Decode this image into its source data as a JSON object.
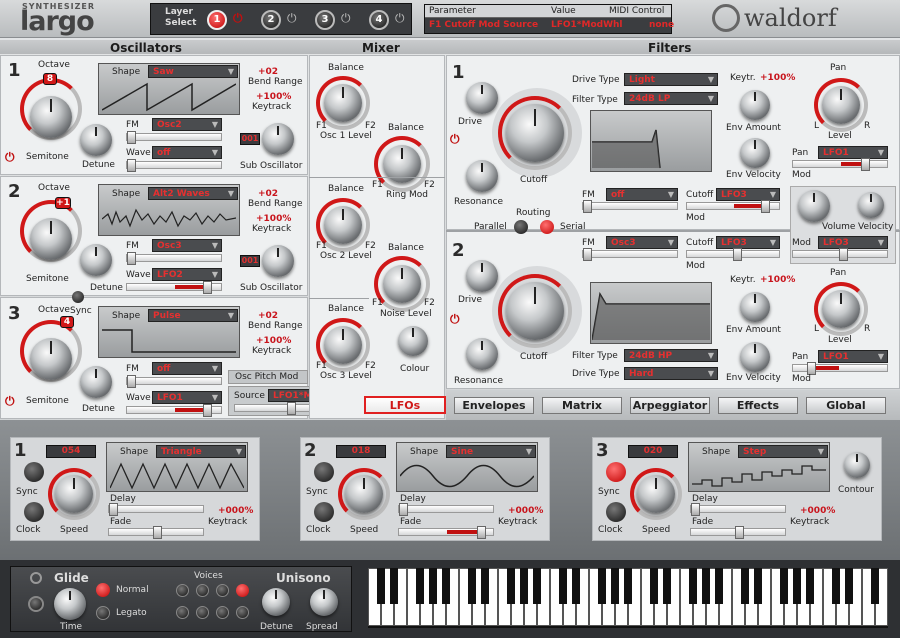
{
  "brand": {
    "top": "SYNTHESIZER",
    "product": "largo",
    "maker": "waldorf"
  },
  "layer_select": {
    "label1": "Layer",
    "label2": "Select",
    "layers": [
      "1",
      "2",
      "3",
      "4"
    ]
  },
  "param_display": {
    "h_param": "Parameter",
    "h_value": "Value",
    "h_midi": "MIDI Control",
    "param": "F1 Cutoff Mod Source",
    "value": "LFO1*ModWhl",
    "midi": "none"
  },
  "sections": {
    "osc": "Oscillators",
    "mixer": "Mixer",
    "filters": "Filters"
  },
  "oscillators": [
    {
      "num": "1",
      "octave_label": "Octave",
      "octave": "8",
      "shape_label": "Shape",
      "shape": "Saw",
      "bend": "+02",
      "bend_label": "Bend Range",
      "keytrack": "+100%",
      "keytrack_label": "Keytrack",
      "fm_label": "FM",
      "fm": "Osc2",
      "wave_label": "Wave",
      "wave": "off",
      "semitone": "Semitone",
      "detune": "Detune",
      "sub_value": "001",
      "sub_label": "Sub Oscillator"
    },
    {
      "num": "2",
      "octave_label": "Octave",
      "octave": "+1",
      "shape_label": "Shape",
      "shape": "Alt2 Waves",
      "bend": "+02",
      "bend_label": "Bend Range",
      "keytrack": "+100%",
      "keytrack_label": "Keytrack",
      "fm_label": "FM",
      "fm": "Osc3",
      "wave_label": "Wave",
      "wave": "LFO2",
      "semitone": "Semitone",
      "detune": "Detune",
      "sub_value": "001",
      "sub_label": "Sub Oscillator"
    },
    {
      "num": "3",
      "octave_label": "Octave",
      "octave": "4",
      "shape_label": "Shape",
      "shape": "Pulse",
      "bend": "+02",
      "bend_label": "Bend Range",
      "keytrack": "+100%",
      "keytrack_label": "Keytrack",
      "fm_label": "FM",
      "fm": "off",
      "wave_label": "Wave",
      "wave": "LFO1",
      "semitone": "Semitone",
      "detune": "Detune",
      "sync": "Sync"
    }
  ],
  "osc_pitch_mod": {
    "title": "Osc Pitch Mod",
    "source_label": "Source",
    "source": "LFO1*ModWhl"
  },
  "mixer": {
    "balance": "Balance",
    "f1": "F1",
    "f2": "F2",
    "osc1": "Osc 1 Level",
    "osc2": "Osc 2 Level",
    "osc3": "Osc 3 Level",
    "ring": "Ring Mod",
    "noise": "Noise Level",
    "colour": "Colour"
  },
  "filters": [
    {
      "num": "1",
      "drive_type_label": "Drive Type",
      "drive_type": "Light",
      "filter_type_label": "Filter Type",
      "filter_type": "24dB LP",
      "drive": "Drive",
      "cutoff": "Cutoff",
      "resonance": "Resonance",
      "keytr": "Keytr.",
      "keytr_value": "+100%",
      "env_amount": "Env Amount",
      "env_velocity": "Env Velocity",
      "fm_label": "FM",
      "fm": "off",
      "cutoff_mod_label": "Cutoff",
      "cutoff_mod": "LFO3",
      "mod_label": "Mod",
      "pan_label": "Pan",
      "pan": "LFO1",
      "pan_title": "Pan",
      "level": "Level",
      "l": "L",
      "r": "R"
    },
    {
      "num": "2",
      "drive_type_label": "Drive Type",
      "drive_type": "Hard",
      "filter_type_label": "Filter Type",
      "filter_type": "24dB HP",
      "drive": "Drive",
      "cutoff": "Cutoff",
      "resonance": "Resonance",
      "keytr": "Keytr.",
      "keytr_value": "+100%",
      "env_amount": "Env Amount",
      "env_velocity": "Env Velocity",
      "fm_label": "FM",
      "fm": "Osc3",
      "cutoff_mod_label": "Cutoff",
      "cutoff_mod": "LFO3",
      "mod_label": "Mod",
      "pan_label": "Pan",
      "pan": "LFO1",
      "pan_title": "Pan",
      "level": "Level",
      "l": "L",
      "r": "R"
    }
  ],
  "routing": {
    "label": "Routing",
    "parallel": "Parallel",
    "serial": "Serial"
  },
  "volume": {
    "volume": "Volume",
    "velocity": "Velocity",
    "mod_label": "Mod",
    "mod": "LFO3"
  },
  "tabs": [
    "LFOs",
    "Envelopes",
    "Matrix",
    "Arpeggiator",
    "Effects",
    "Global"
  ],
  "lfos": [
    {
      "num": "1",
      "value": "054",
      "shape_label": "Shape",
      "shape": "Triangle",
      "sync": "Sync",
      "clock": "Clock",
      "speed": "Speed",
      "delay": "Delay",
      "fade": "Fade",
      "keytrack": "+000%",
      "keytrack_label": "Keytrack"
    },
    {
      "num": "2",
      "value": "018",
      "shape_label": "Shape",
      "shape": "Sine",
      "sync": "Sync",
      "clock": "Clock",
      "speed": "Speed",
      "delay": "Delay",
      "fade": "Fade",
      "keytrack": "+000%",
      "keytrack_label": "Keytrack"
    },
    {
      "num": "3",
      "value": "020",
      "shape_label": "Shape",
      "shape": "Step",
      "sync": "Sync",
      "clock": "Clock",
      "speed": "Speed",
      "delay": "Delay",
      "fade": "Fade",
      "keytrack": "+000%",
      "keytrack_label": "Keytrack",
      "contour": "Contour"
    }
  ],
  "glide": {
    "title": "Glide",
    "time": "Time",
    "normal": "Normal",
    "legato": "Legato"
  },
  "voices": {
    "title": "Voices"
  },
  "unisono": {
    "title": "Unisono",
    "detune": "Detune",
    "spread": "Spread"
  }
}
